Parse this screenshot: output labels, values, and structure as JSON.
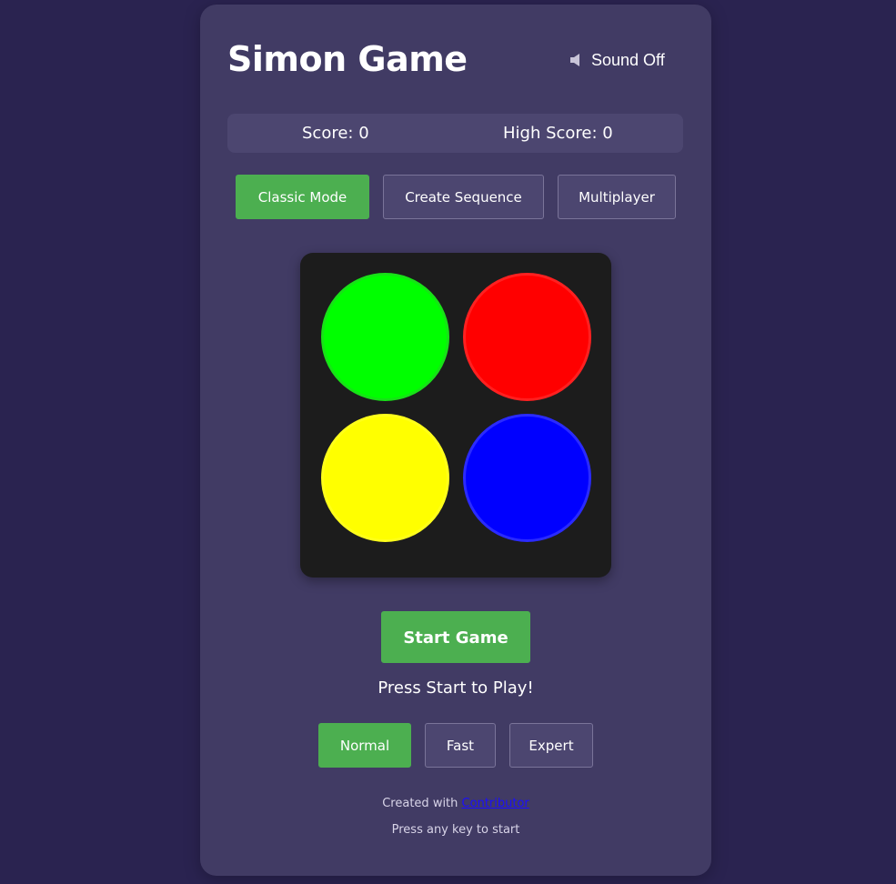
{
  "header": {
    "title": "Simon Game",
    "sound_label": "Sound Off",
    "sound_icon": "speaker-muted-icon"
  },
  "scores": {
    "score_text": "Score: 0",
    "high_score_text": "High Score: 0"
  },
  "modes": {
    "active": "Classic Mode",
    "items": [
      "Classic Mode",
      "Create Sequence",
      "Multiplayer"
    ]
  },
  "board": {
    "pads": [
      {
        "name": "green",
        "color": "#00ff00"
      },
      {
        "name": "red",
        "color": "#ff0000"
      },
      {
        "name": "yellow",
        "color": "#ffff00"
      },
      {
        "name": "blue",
        "color": "#0000ff"
      }
    ],
    "background": "#1c1c1c"
  },
  "controls": {
    "start_label": "Start Game",
    "status_text": "Press Start to Play!"
  },
  "speeds": {
    "active": "Normal",
    "items": [
      "Normal",
      "Fast",
      "Expert"
    ]
  },
  "footer": {
    "created_prefix": "Created with",
    "created_link": "Contributor",
    "hint": "Press any key to start"
  },
  "colors": {
    "page_background": "#2a2350",
    "card_background": "#413b64",
    "accent_green": "#4caf50",
    "link": "#1a0dff"
  }
}
